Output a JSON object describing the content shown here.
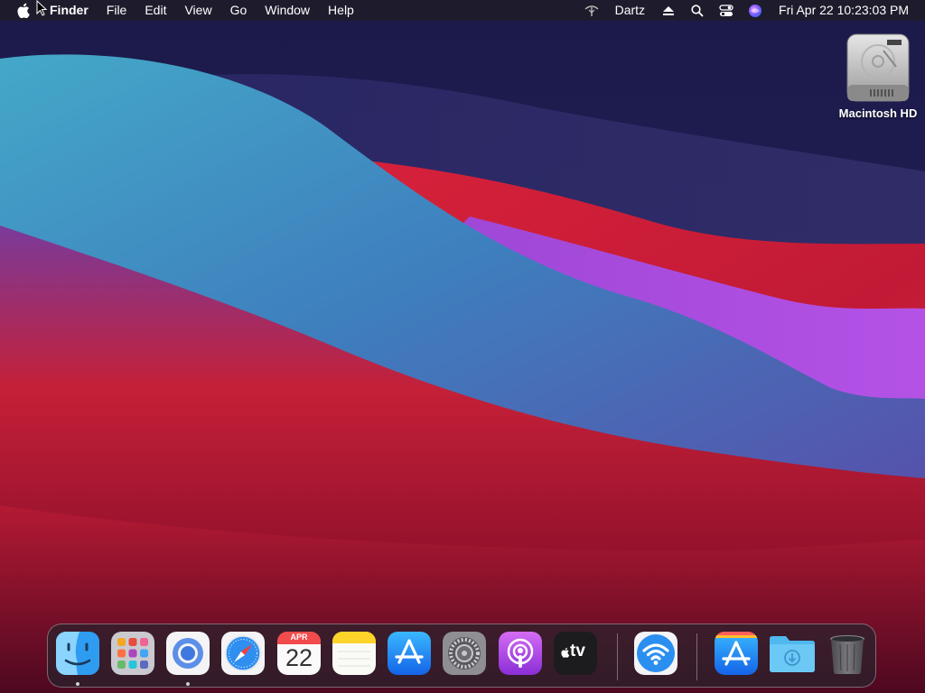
{
  "menubar": {
    "app_name": "Finder",
    "menus": [
      "File",
      "Edit",
      "View",
      "Go",
      "Window",
      "Help"
    ],
    "user_name": "Dartz",
    "datetime": "Fri Apr 22  10:23:03 PM",
    "status_icons": [
      "wifi-icon",
      "eject-icon",
      "spotlight-icon",
      "control-center-icon",
      "siri-icon"
    ]
  },
  "desktop": {
    "icons": [
      {
        "label": "Macintosh HD",
        "icon": "hard-drive-icon"
      }
    ]
  },
  "dock": {
    "apps": [
      {
        "name": "finder",
        "icon": "finder-icon",
        "running": true
      },
      {
        "name": "launchpad",
        "icon": "launchpad-icon",
        "running": false
      },
      {
        "name": "chromium",
        "icon": "chromium-icon",
        "running": true
      },
      {
        "name": "safari",
        "icon": "safari-icon",
        "running": false
      },
      {
        "name": "calendar",
        "icon": "calendar-icon",
        "running": false,
        "month": "APR",
        "day": "22"
      },
      {
        "name": "notes",
        "icon": "notes-icon",
        "running": false
      },
      {
        "name": "app-store",
        "icon": "app-store-icon",
        "running": false
      },
      {
        "name": "system-preferences",
        "icon": "gear-icon",
        "running": false
      },
      {
        "name": "podcasts",
        "icon": "podcasts-icon",
        "running": false
      },
      {
        "name": "apple-tv",
        "icon": "apple-tv-icon",
        "running": false,
        "label": "tv"
      },
      {
        "name": "wireless-diagnostics",
        "icon": "wifi-app-icon",
        "running": false
      },
      {
        "name": "app-installer",
        "icon": "app-store-icon",
        "running": false
      },
      {
        "name": "downloads",
        "icon": "downloads-folder-icon",
        "running": false
      },
      {
        "name": "trash",
        "icon": "trash-icon",
        "running": false
      }
    ]
  },
  "colors": {
    "menubar_bg": "#1e1c2c",
    "wallpaper_navy": "#1c1740",
    "wallpaper_red": "#c8203a",
    "wallpaper_teal": "#3fa0c4",
    "wallpaper_purple": "#a64ad8"
  }
}
